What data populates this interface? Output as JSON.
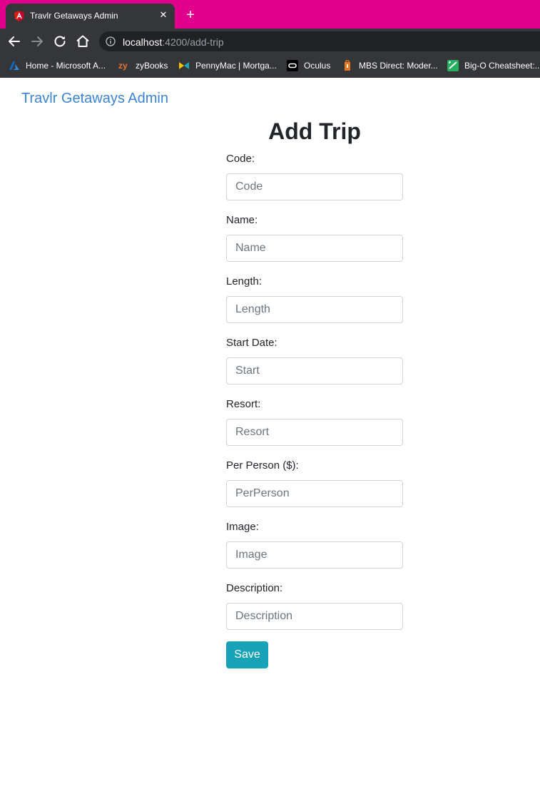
{
  "browser": {
    "tab": {
      "title": "Travlr Getaways Admin",
      "close_glyph": "✕",
      "favicon": "angular-icon"
    },
    "new_tab_glyph": "+",
    "url": {
      "host": "localhost",
      "path": ":4200/add-trip"
    },
    "bookmarks": [
      {
        "label": "Home - Microsoft A...",
        "icon": "azure-icon"
      },
      {
        "label": "zyBooks",
        "icon": "zybooks-icon"
      },
      {
        "label": "PennyMac | Mortga...",
        "icon": "pennymac-icon"
      },
      {
        "label": "Oculus",
        "icon": "oculus-icon"
      },
      {
        "label": "MBS Direct: Moder...",
        "icon": "mbs-direct-icon"
      },
      {
        "label": "Big-O Cheatsheet:...",
        "icon": "big-o-icon"
      }
    ],
    "colors": {
      "tabstrip": "#e1008c",
      "chrome": "#35363a",
      "omnibox": "#202124"
    }
  },
  "app": {
    "brand": "Travlr Getaways Admin",
    "title": "Add Trip",
    "fields": [
      {
        "label": "Code:",
        "placeholder": "Code",
        "value": ""
      },
      {
        "label": "Name:",
        "placeholder": "Name",
        "value": ""
      },
      {
        "label": "Length:",
        "placeholder": "Length",
        "value": ""
      },
      {
        "label": "Start Date:",
        "placeholder": "Start",
        "value": ""
      },
      {
        "label": "Resort:",
        "placeholder": "Resort",
        "value": ""
      },
      {
        "label": "Per Person ($):",
        "placeholder": "PerPerson",
        "value": ""
      },
      {
        "label": "Image:",
        "placeholder": "Image",
        "value": ""
      },
      {
        "label": "Description:",
        "placeholder": "Description",
        "value": ""
      }
    ],
    "save_label": "Save",
    "colors": {
      "brand": "#3a84d4",
      "save_button": "#17a2b8"
    }
  }
}
